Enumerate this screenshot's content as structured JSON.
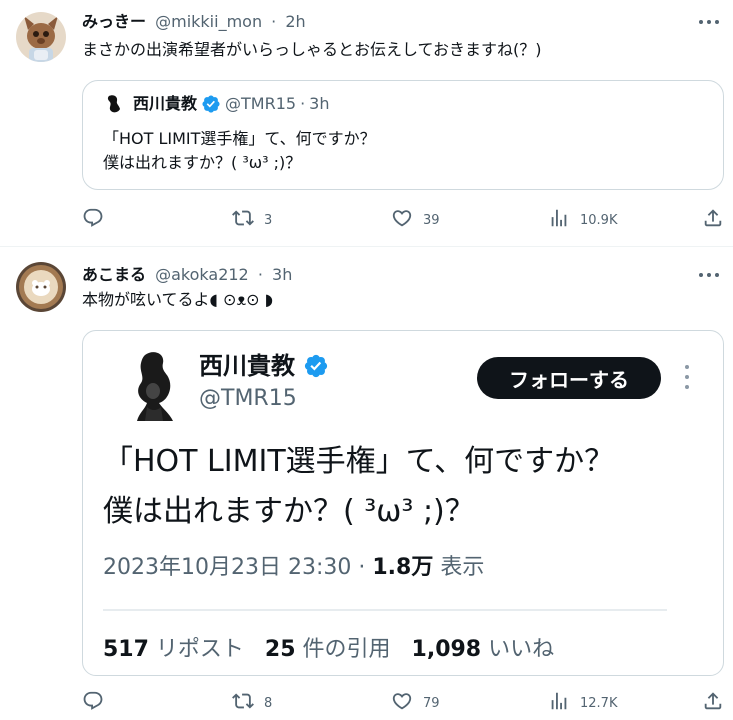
{
  "tweets": [
    {
      "author_name": "みっきー",
      "handle": "@mikkii_mon",
      "separator": "·",
      "time": "2h",
      "text": "まさかの出演希望者がいらっしゃるとお伝えしておきますね(？)",
      "quote": {
        "author_name": "西川貴教",
        "handle": "@TMR15",
        "separator": "·",
        "time": "3h",
        "text_line1": "「HOT LIMIT選手権」て、何ですか？",
        "text_line2": "僕は出れますか？( ³ω³ ;)？"
      },
      "replies": "",
      "retweets": "3",
      "likes": "39",
      "views": "10.9K"
    },
    {
      "author_name": "あこまる",
      "handle": "@akoka212",
      "separator": "·",
      "time": "3h",
      "text": "本物が呟いてるよ◖ ⊙ᴥ⊙ ◗",
      "embed": {
        "author_name": "西川貴教",
        "handle": "@TMR15",
        "follow_label": "フォローする",
        "text_line1": "「HOT LIMIT選手権」て、何ですか？",
        "text_line2": "僕は出れますか？( ³ω³ ;)？",
        "datetime": "2023年10月23日 23:30",
        "meta_separator": " · ",
        "views_value": "1.8万",
        "views_label": " 表示",
        "reposts_value": "517",
        "reposts_label": " リポスト",
        "quotes_value": "25",
        "quotes_label": " 件の引用",
        "likes_value": "1,098",
        "likes_label": " いいね"
      },
      "replies": "",
      "retweets": "8",
      "likes": "79",
      "views": "12.7K"
    }
  ],
  "colors": {
    "text": "#0f1419",
    "secondary": "#536471",
    "border": "#cfd9de",
    "verified": "#1d9bf0",
    "follow_bg": "#0f1419"
  },
  "icons": [
    "reply-icon",
    "retweet-icon",
    "like-icon",
    "views-icon",
    "share-icon",
    "more-icon",
    "verified-badge-icon"
  ]
}
